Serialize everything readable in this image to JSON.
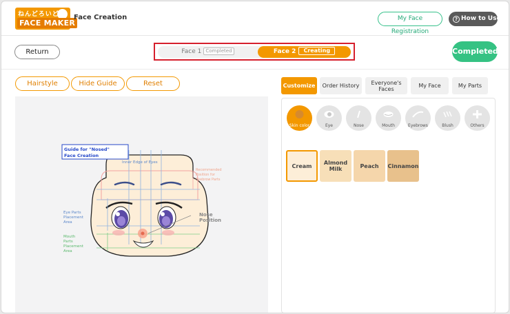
{
  "header": {
    "logo_top": "ねんどろいど",
    "logo_main": "FACE MAKER",
    "app_title": "Face Creation",
    "registration_label": "My Face Registration",
    "how_to_use_label": "How to Use"
  },
  "nav": {
    "return_label": "Return",
    "face1": {
      "label": "Face 1",
      "status": "Completed"
    },
    "face2": {
      "label": "Face 2",
      "status": "Creating"
    },
    "completed_label": "Completed"
  },
  "tools": {
    "hairstyle": "Hairstyle",
    "hide_guide": "Hide Guide",
    "reset": "Reset"
  },
  "guide": {
    "title_line1": "Guide for \"Nosed\"",
    "title_line2": "Face Creation",
    "inner_edge": "Inner Edge of Eyes",
    "eyebrow_line1": "Recommended",
    "eyebrow_line2": "Position for",
    "eyebrow_line3": "Eyebrow Parts",
    "eye_line1": "Eye Parts",
    "eye_line2": "Placement",
    "eye_line3": "Area",
    "nose_line1": "Nose",
    "nose_line2": "Position",
    "mouth_line1": "Mouth",
    "mouth_line2": "Parts",
    "mouth_line3": "Placement",
    "mouth_line4": "Area"
  },
  "tabs": [
    {
      "label": "Customize",
      "active": true
    },
    {
      "label": "Order History",
      "active": false
    },
    {
      "label": "Everyone's Faces",
      "active": false
    },
    {
      "label": "My Face",
      "active": false
    },
    {
      "label": "My Parts",
      "active": false
    }
  ],
  "categories": [
    {
      "label": "Skin color",
      "icon": "skin-color-icon",
      "active": true
    },
    {
      "label": "Eye",
      "icon": "eye-icon",
      "active": false
    },
    {
      "label": "Nose",
      "icon": "nose-icon",
      "active": false
    },
    {
      "label": "Mouth",
      "icon": "mouth-icon",
      "active": false
    },
    {
      "label": "Eyebrows",
      "icon": "eyebrows-icon",
      "active": false
    },
    {
      "label": "Blush",
      "icon": "blush-icon",
      "active": false
    },
    {
      "label": "Others",
      "icon": "plus-icon",
      "active": false
    }
  ],
  "skin_swatches": [
    {
      "label": "Cream",
      "color": "#fdeed8",
      "selected": true
    },
    {
      "label": "Almond Milk",
      "color": "#f7dfb8",
      "selected": false
    },
    {
      "label": "Peach",
      "color": "#f5d6ab",
      "selected": false
    },
    {
      "label": "Cinnamon",
      "color": "#e8c18c",
      "selected": false
    }
  ],
  "colors": {
    "accent": "#f39800",
    "success": "#35c283",
    "highlight_border": "#d61f2c"
  }
}
